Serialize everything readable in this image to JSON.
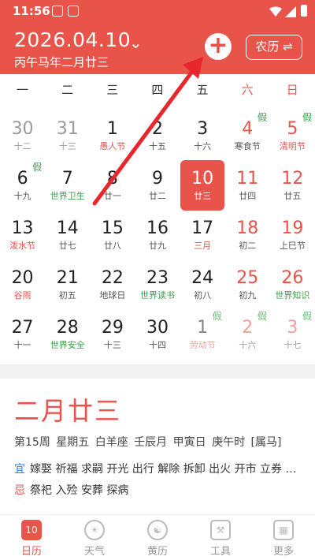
{
  "status": {
    "time": "11:56"
  },
  "header": {
    "date": "2026.04.10",
    "lunar": "丙午马年二月廿三",
    "chevron": "⌄",
    "add": "+",
    "lunar_toggle": "农历 ⇌"
  },
  "weekdays": [
    "一",
    "二",
    "三",
    "四",
    "五",
    "六",
    "日"
  ],
  "calendar": {
    "rows": [
      [
        {
          "n": "30",
          "s": "十二",
          "other": true
        },
        {
          "n": "31",
          "s": "十三",
          "other": true
        },
        {
          "n": "1",
          "s": "愚人节",
          "sc": "red"
        },
        {
          "n": "2",
          "s": "十五"
        },
        {
          "n": "3",
          "s": "十六"
        },
        {
          "n": "4",
          "s": "寒食节",
          "we": true,
          "b": "假"
        },
        {
          "n": "5",
          "s": "清明节",
          "we": true,
          "sc": "red",
          "b": "假"
        }
      ],
      [
        {
          "n": "6",
          "s": "十九",
          "b": "假"
        },
        {
          "n": "7",
          "s": "世界卫生",
          "sc": "green"
        },
        {
          "n": "8",
          "s": "廿一"
        },
        {
          "n": "9",
          "s": "廿二"
        },
        {
          "n": "10",
          "s": "廿三",
          "sel": true
        },
        {
          "n": "11",
          "s": "廿四",
          "we": true
        },
        {
          "n": "12",
          "s": "廿五",
          "we": true
        }
      ],
      [
        {
          "n": "13",
          "s": "泼水节",
          "sc": "red"
        },
        {
          "n": "14",
          "s": "廿七"
        },
        {
          "n": "15",
          "s": "廿八"
        },
        {
          "n": "16",
          "s": "廿九"
        },
        {
          "n": "17",
          "s": "三月",
          "sc": "red"
        },
        {
          "n": "18",
          "s": "初二",
          "we": true
        },
        {
          "n": "19",
          "s": "上巳节",
          "we": true
        }
      ],
      [
        {
          "n": "20",
          "s": "谷雨",
          "sc": "red"
        },
        {
          "n": "21",
          "s": "初五"
        },
        {
          "n": "22",
          "s": "地球日"
        },
        {
          "n": "23",
          "s": "世界读书",
          "sc": "green"
        },
        {
          "n": "24",
          "s": "初八"
        },
        {
          "n": "25",
          "s": "初九",
          "we": true
        },
        {
          "n": "26",
          "s": "世界知识",
          "we": true,
          "sc": "green"
        }
      ],
      [
        {
          "n": "27",
          "s": "十一"
        },
        {
          "n": "28",
          "s": "世界安全",
          "sc": "green"
        },
        {
          "n": "29",
          "s": "十三"
        },
        {
          "n": "30",
          "s": "十四"
        },
        {
          "n": "1",
          "s": "劳动节",
          "sc": "red",
          "faded": true,
          "b": "假"
        },
        {
          "n": "2",
          "s": "十六",
          "we": true,
          "faded": true,
          "b": "假"
        },
        {
          "n": "3",
          "s": "十七",
          "we": true,
          "faded": true,
          "b": "假"
        }
      ]
    ]
  },
  "detail": {
    "big": "二月廿三",
    "info": "第15周 星期五 白羊座  壬辰月 甲寅日 庚午时 [属马]",
    "yi_label": "宜",
    "yi": "嫁娶 祈福 求嗣 开光 出行 解除 拆卸 出火 开市 立券 …",
    "ji_label": "忌",
    "ji": "祭祀 入殓 安葬 探病"
  },
  "tabs": [
    {
      "label": "日历",
      "icon": "10",
      "active": true
    },
    {
      "label": "天气",
      "icon": "☀"
    },
    {
      "label": "黄历",
      "icon": "☯"
    },
    {
      "label": "工具",
      "icon": "⚒"
    },
    {
      "label": "更多",
      "icon": "▦"
    }
  ],
  "colors": {
    "brand": "#e8534a",
    "holiday_green": "#3aa14a",
    "yi_blue": "#2b7fd7"
  }
}
